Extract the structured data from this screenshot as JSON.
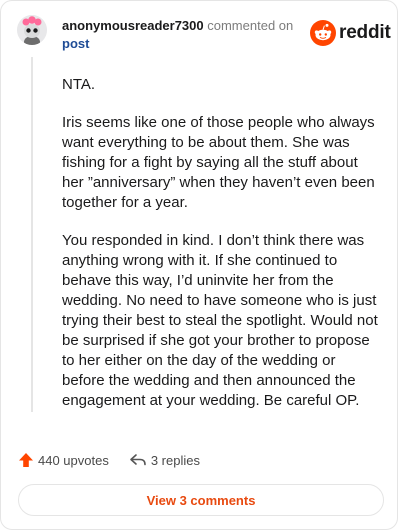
{
  "header": {
    "username": "anonymousreader7300",
    "commented_on": "commented on",
    "post_link": "post",
    "brand": "reddit"
  },
  "comment": {
    "paragraphs": [
      "NTA.",
      "Iris seems like one of those people who always want everything to be about them. She was fishing for a fight by saying all the stuff about her ”anniversary” when they haven’t even been together for a year.",
      "You responded in kind. I don’t think there was anything wrong with it. If she continued to behave this way, I’d uninvite her from the wedding. No need to have someone who is just trying their best to steal the spotlight. Would not be surprised if she got your brother to propose to her either on the day of the wedding or before the wedding and then announced the engagement at your wedding. Be careful OP."
    ]
  },
  "actions": {
    "upvotes": "440 upvotes",
    "replies": "3 replies"
  },
  "footer": {
    "view_comments": "View 3 comments"
  },
  "colors": {
    "accent": "#e84a10",
    "link": "#1f4c96",
    "reddit_orange": "#ff4500",
    "upvote_arrow": "#ff4500"
  },
  "icons": {
    "avatar": "snoo-avatar",
    "logo": "reddit-snoo-icon",
    "upvote": "upvote-arrow-icon",
    "reply": "reply-arrow-icon"
  }
}
